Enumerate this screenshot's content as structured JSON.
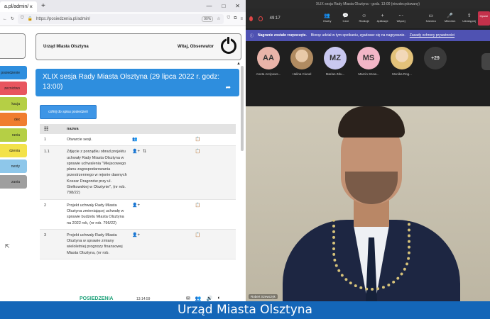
{
  "browser": {
    "tab_title": "a.pl/admin/",
    "url": "https://posiedzenia.pl/admin/",
    "zoom": "90%",
    "header_org": "Urząd Miasta Olsztyna",
    "header_welcome": "Witaj, Obserwator",
    "sidebar": [
      {
        "label": "posiedzenie",
        "color": "#2e8ede"
      },
      {
        "label": "zecnictwo",
        "color": "#e8555e"
      },
      {
        "label": "kacja",
        "color": "#b5cf45"
      },
      {
        "label": "dex",
        "color": "#f07d2f"
      },
      {
        "label": "rania",
        "color": "#b5cf45"
      },
      {
        "label": "dzenia",
        "color": "#f3e24a"
      },
      {
        "label": "nenty",
        "color": "#8ec7ea"
      },
      {
        "label": "zania",
        "color": "#9e9e9e"
      }
    ],
    "session_title": "XLIX sesja Rady Miasta Olsztyna (29 lipca 2022 r. godz: 13:00)",
    "back_button": "cofnij do spisu posiedzeń",
    "agenda_header": {
      "num": "☷",
      "name": "nazwa"
    },
    "agenda": [
      {
        "num": "1",
        "title": "Otwarcie sesji.",
        "icons": [
          "👥"
        ]
      },
      {
        "num": "1.1",
        "title": "Zdjęcie z porządku obrad projektu uchwały Rady Miasta Olsztyna w sprawie uchwalenia \"Miejscowego planu zagospodarowania przestrzennego w rejonie dawnych Koszar Dragonów przy ul. Giełkowskiej w Olsztynie\", (nr rob. 798/22)",
        "icons": [
          "👤+",
          "⇅"
        ]
      },
      {
        "num": "2",
        "title": "Projekt uchwały Rady Miasta Olsztyna zmieniającej uchwałę w sprawie budżetu Miasta Olsztyna na 2022 rok, (nr rob. 796/22)",
        "icons": [
          "👤+"
        ]
      },
      {
        "num": "3",
        "title": "Projekt uchwały Rady Miasta Olsztyna w sprawie zmiany wieloletniej prognozy finansowej Miasta Olsztyna, (nr rob.",
        "icons": [
          "👤+"
        ]
      }
    ],
    "footer_logo": "POSIEDZENIA",
    "footer_time": "13:14:59"
  },
  "meeting": {
    "window_title": "XLIX sesja Rady Miasta Olsztyna - godz. 13:00 (niezdecydowany)",
    "timer": "49:17",
    "tools": [
      {
        "glyph": "👥",
        "label": "Osoby"
      },
      {
        "glyph": "💬",
        "label": "Czat"
      },
      {
        "glyph": "☺",
        "label": "Reakcje"
      },
      {
        "glyph": "+",
        "label": "Aplikacje"
      },
      {
        "glyph": "⋯",
        "label": "Więcej"
      }
    ],
    "right_tools": [
      {
        "glyph": "▭",
        "label": "Kamera"
      },
      {
        "glyph": "🎤",
        "label": "Mikrofon"
      },
      {
        "glyph": "⇪",
        "label": "Udostępnij"
      }
    ],
    "leave_label": "Opuść",
    "banner_title": "Nagranie zostało rozpoczęte.",
    "banner_text": "Biorąc udział w tym spotkaniu, zgadzasz się na nagrywanie.",
    "banner_link": "Zasady ochrony prywatności",
    "participants": [
      {
        "initials": "AA",
        "name": "Aneta Arcipows...",
        "color": "#e9b4a9",
        "photo": false
      },
      {
        "initials": "",
        "name": "Halina Ciunel",
        "color": "",
        "photo": true
      },
      {
        "initials": "MZ",
        "name": "Marian Zdu...",
        "color": "#c9c8f0",
        "photo": false
      },
      {
        "initials": "MS",
        "name": "Marcin Szew...",
        "color": "#f2b6c7",
        "photo": false
      },
      {
        "initials": "",
        "name": "Monika Rog...",
        "color": "",
        "photo": true
      }
    ],
    "more_count": "+29",
    "speaker_name": "Robert Szewczyk"
  },
  "caption": "Urząd Miasta Olsztyna"
}
